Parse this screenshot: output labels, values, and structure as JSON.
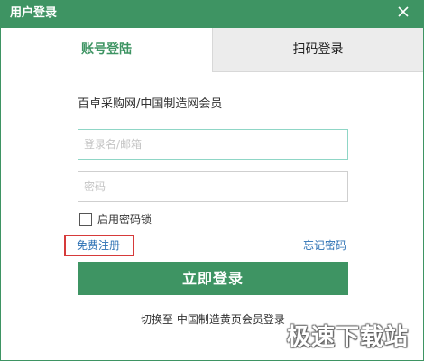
{
  "window": {
    "title": "用户登录",
    "close_icon": "close-icon"
  },
  "tabs": [
    {
      "label": "账号登陆",
      "active": true
    },
    {
      "label": "扫码登录",
      "active": false
    }
  ],
  "form": {
    "site_label": "百卓采购网/中国制造网会员",
    "username_placeholder": "登录名/邮箱",
    "username_value": "",
    "password_placeholder": "密码",
    "password_value": "",
    "remember_label": "启用密码锁",
    "remember_checked": false,
    "register_label": "免费注册",
    "forgot_label": "忘记密码",
    "login_label": "立即登录",
    "switch_prefix": "切换至",
    "switch_link": "中国制造黄页会员登录"
  },
  "watermark": "极速下载站",
  "colors": {
    "brand_green": "#3e9463",
    "link_blue": "#2a6fb3",
    "highlight_red": "#d63a3a",
    "focus_border": "#8fd6c6"
  }
}
